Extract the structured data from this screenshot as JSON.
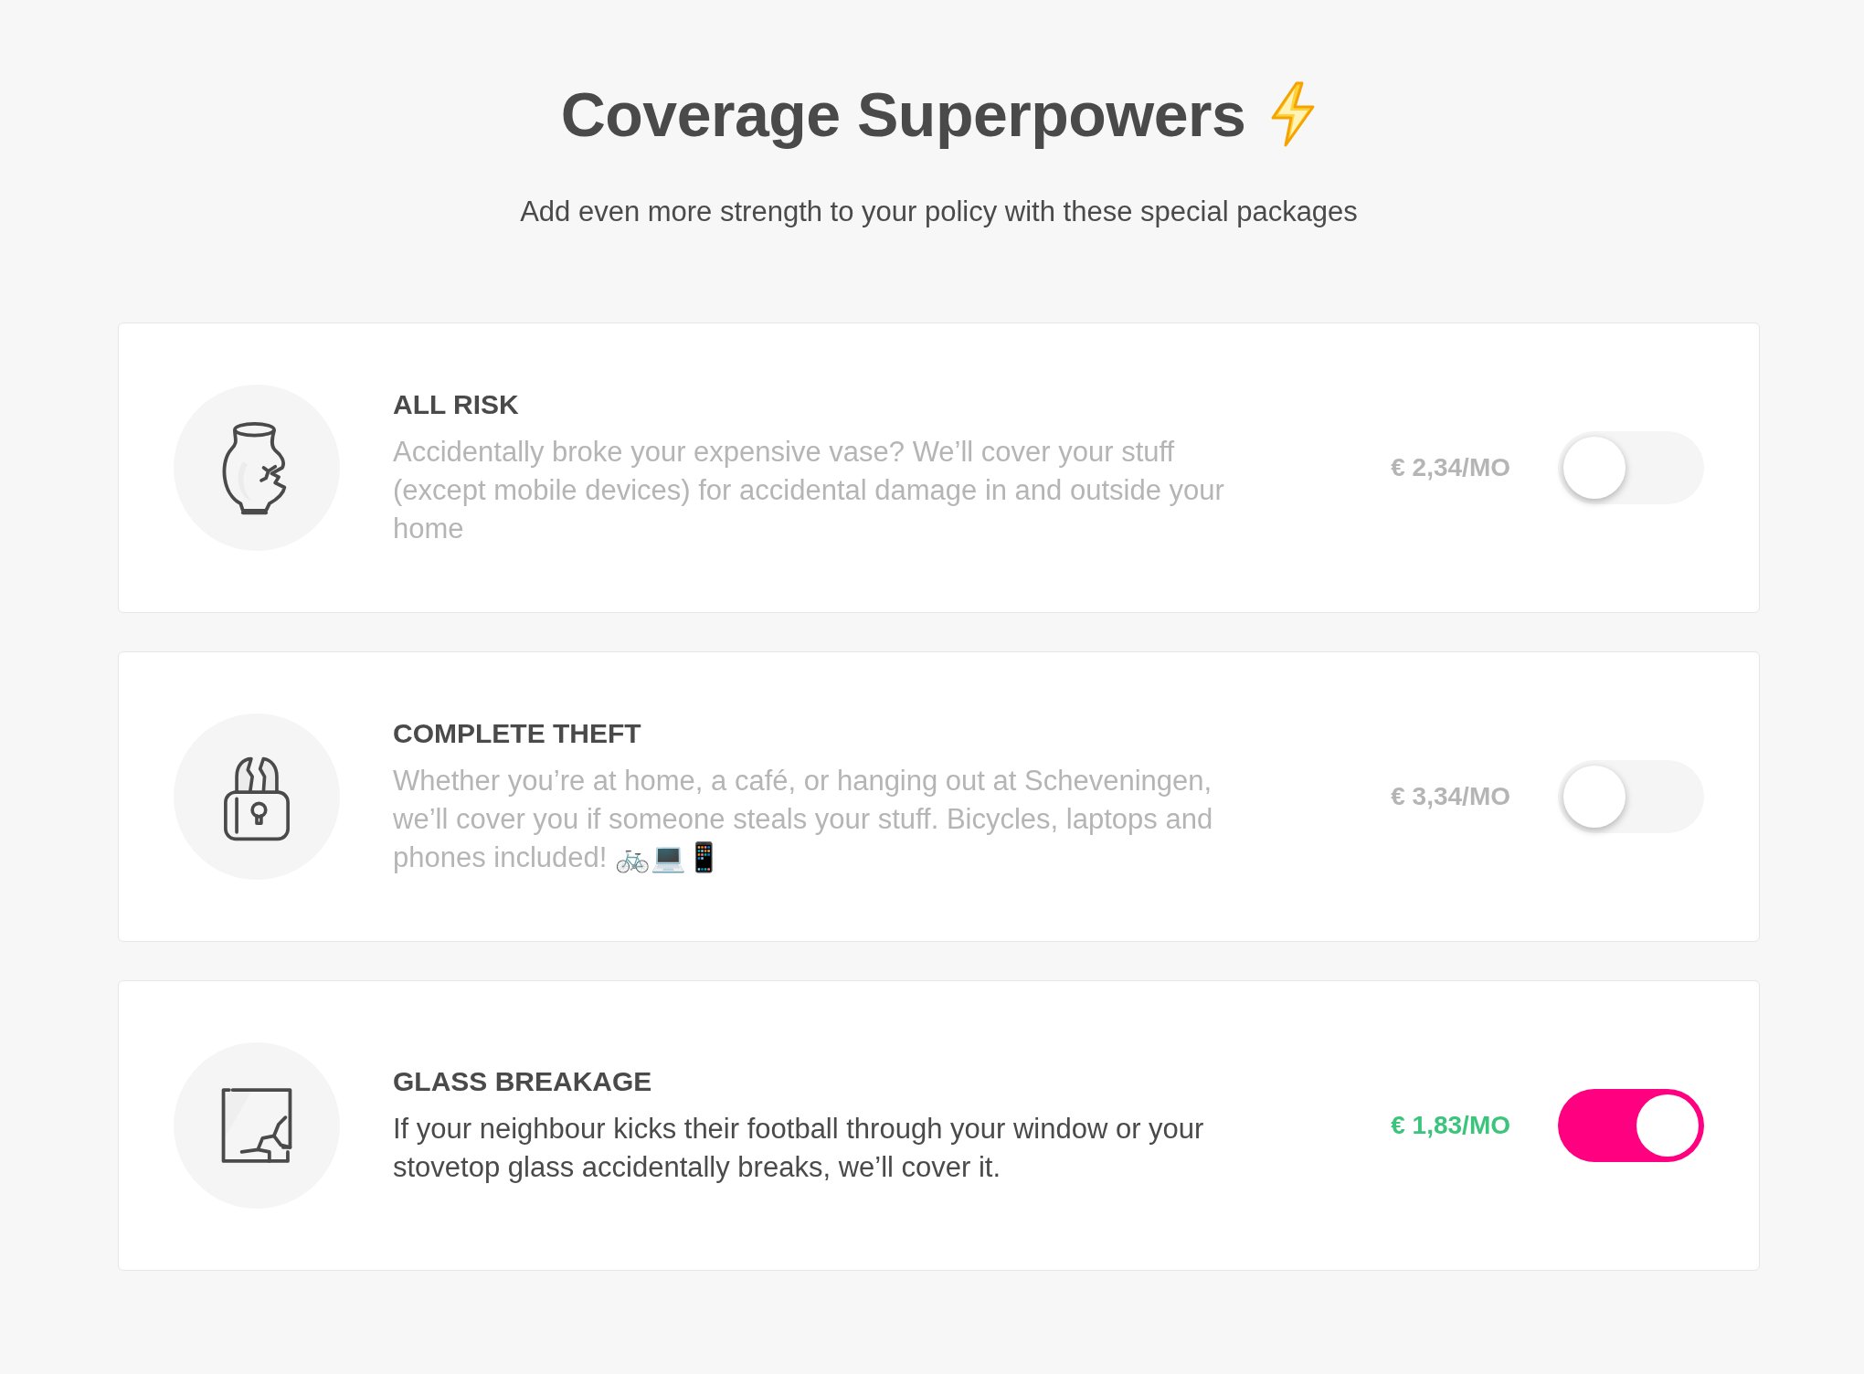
{
  "header": {
    "title": "Coverage Superpowers",
    "subtitle": "Add even more strength to your policy with these special packages"
  },
  "packages": [
    {
      "name": "ALL RISK",
      "description": "Accidentally broke your expensive vase? We’ll cover your stuff (except mobile devices) for accidental damage in and outside your home",
      "price": "€ 2,34/MO",
      "on": false
    },
    {
      "name": "COMPLETE THEFT",
      "description": "Whether you’re at home, a café, or hanging out at Scheveningen, we’ll cover you if someone steals your stuff. Bicycles, laptops and phones included! 🚲💻📱",
      "price": "€ 3,34/MO",
      "on": false
    },
    {
      "name": "GLASS BREAKAGE",
      "description": "If your neighbour kicks their football through your window or your stovetop glass accidentally breaks, we’ll cover it.",
      "price": "€ 1,83/MO",
      "on": true
    }
  ]
}
